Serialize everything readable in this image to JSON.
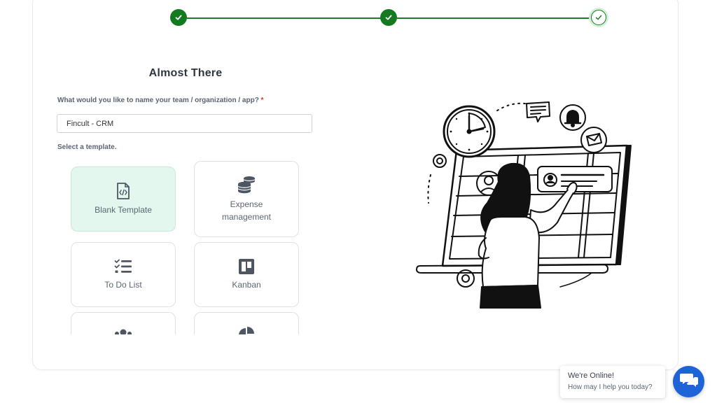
{
  "wizard": {
    "steps": [
      {
        "status": "complete"
      },
      {
        "status": "complete"
      },
      {
        "status": "current-complete"
      }
    ],
    "title": "Almost There",
    "name_question": "What would you like to name your team / organization / app?",
    "required_mark": "*",
    "name_value": "Fincult - CRM",
    "template_label": "Select a template."
  },
  "templates": [
    {
      "label": "Blank Template",
      "icon": "code-file-icon",
      "selected": true
    },
    {
      "label": "Expense management",
      "icon": "coins-icon",
      "selected": false
    },
    {
      "label": "To Do List",
      "icon": "checklist-icon",
      "selected": false
    },
    {
      "label": "Kanban",
      "icon": "kanban-icon",
      "selected": false
    },
    {
      "label": "",
      "icon": "team-icon",
      "selected": false
    },
    {
      "label": "",
      "icon": "pie-chart-icon",
      "selected": false
    }
  ],
  "chat": {
    "title": "We're Online!",
    "subtitle": "How may I help you today?"
  },
  "colors": {
    "step_green": "#137a1f",
    "selected_tile": "#e3f7ee",
    "chat_blue": "#1e63d8",
    "required_red": "#d9342b"
  }
}
